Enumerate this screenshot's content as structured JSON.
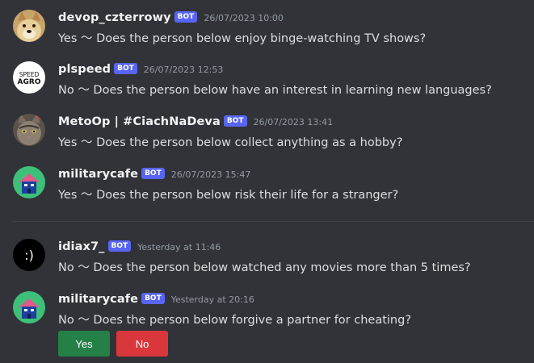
{
  "messages": [
    {
      "username": "devop_czterrowy",
      "badge": "BOT",
      "time": "26/07/2023 10:00",
      "text": "Yes 〜 Does the person below enjoy binge-watching TV shows?",
      "avatar": "doge-avatar"
    },
    {
      "username": "plspeed",
      "badge": "BOT",
      "time": "26/07/2023 12:53",
      "text": "No 〜 Does the person below have an interest in learning new languages?",
      "avatar": "speed-agro-logo-avatar",
      "avatar_text": [
        "SPEED",
        "AGRO"
      ]
    },
    {
      "username": "MetoOp | #CiachNaDeva",
      "badge": "BOT",
      "time": "26/07/2023 13:41",
      "text": "Yes 〜 Does the person below collect anything as a hobby?",
      "avatar": "cat-avatar"
    },
    {
      "username": "militarycafe",
      "badge": "BOT",
      "time": "26/07/2023 15:47",
      "text": "Yes 〜 Does the person below risk their life for a stranger?",
      "avatar": "house-avatar"
    },
    {
      "username": "idiax7_",
      "badge": "BOT",
      "time": "Yesterday at 11:46",
      "text": "No 〜 Does the person below watched any movies more than 5 times?",
      "avatar": "smiley-avatar",
      "avatar_text": ":)"
    },
    {
      "username": "militarycafe",
      "badge": "BOT",
      "time": "Yesterday at 20:16",
      "text": "No 〜 Does the person below forgive a partner for cheating?",
      "avatar": "house-avatar"
    }
  ],
  "buttons": {
    "yes": "Yes",
    "no": "No"
  },
  "colors": {
    "background": "#313338",
    "badge": "#5865f2",
    "yes": "#248046",
    "no": "#da373c"
  }
}
